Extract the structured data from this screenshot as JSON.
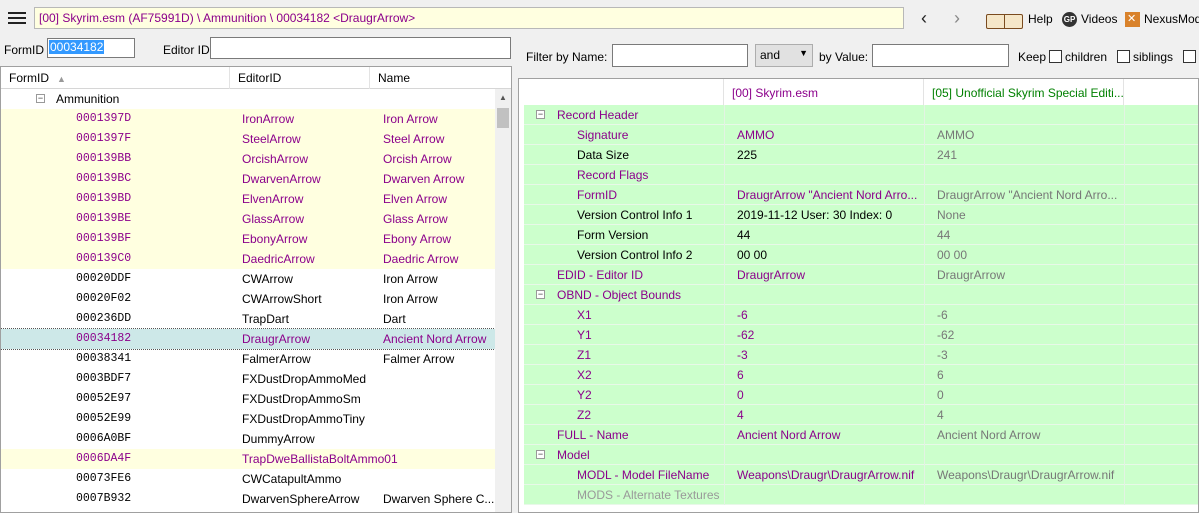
{
  "path": "[00] Skyrim.esm (AF75991D) \\ Ammunition \\ 00034182 <DraugrArrow>",
  "links": {
    "help": "Help",
    "videos": "Videos",
    "nexus": "NexusMods"
  },
  "icons": {
    "menu": "hamburger-icon",
    "back": "back-arrow-icon",
    "forward": "forward-arrow-icon",
    "help": "book-icon",
    "videos": "gp-icon",
    "nexus": "nexus-icon"
  },
  "formid": {
    "label": "FormID",
    "value": "00034182"
  },
  "editorid": {
    "label": "Editor ID",
    "value": ""
  },
  "left": {
    "headers": [
      "FormID",
      "EditorID",
      "Name"
    ],
    "group": "Ammunition",
    "rows": [
      {
        "formid": "0001397D",
        "editorid": "IronArrow",
        "name": "Iron Arrow",
        "style": "yellow"
      },
      {
        "formid": "0001397F",
        "editorid": "SteelArrow",
        "name": "Steel Arrow",
        "style": "yellow"
      },
      {
        "formid": "000139BB",
        "editorid": "OrcishArrow",
        "name": "Orcish Arrow",
        "style": "yellow"
      },
      {
        "formid": "000139BC",
        "editorid": "DwarvenArrow",
        "name": "Dwarven Arrow",
        "style": "yellow"
      },
      {
        "formid": "000139BD",
        "editorid": "ElvenArrow",
        "name": "Elven Arrow",
        "style": "yellow"
      },
      {
        "formid": "000139BE",
        "editorid": "GlassArrow",
        "name": "Glass Arrow",
        "style": "yellow"
      },
      {
        "formid": "000139BF",
        "editorid": "EbonyArrow",
        "name": "Ebony Arrow",
        "style": "yellow"
      },
      {
        "formid": "000139C0",
        "editorid": "DaedricArrow",
        "name": "Daedric Arrow",
        "style": "yellow"
      },
      {
        "formid": "00020DDF",
        "editorid": "CWArrow",
        "name": "Iron Arrow",
        "style": "plain"
      },
      {
        "formid": "00020F02",
        "editorid": "CWArrowShort",
        "name": "Iron Arrow",
        "style": "plain"
      },
      {
        "formid": "000236DD",
        "editorid": "TrapDart",
        "name": "Dart",
        "style": "plain"
      },
      {
        "formid": "00034182",
        "editorid": "DraugrArrow",
        "name": "Ancient Nord Arrow",
        "style": "selected"
      },
      {
        "formid": "00038341",
        "editorid": "FalmerArrow",
        "name": "Falmer Arrow",
        "style": "plain"
      },
      {
        "formid": "0003BDF7",
        "editorid": "FXDustDropAmmoMed",
        "name": "",
        "style": "plain"
      },
      {
        "formid": "00052E97",
        "editorid": "FXDustDropAmmoSm",
        "name": "",
        "style": "plain"
      },
      {
        "formid": "00052E99",
        "editorid": "FXDustDropAmmoTiny",
        "name": "",
        "style": "plain"
      },
      {
        "formid": "0006A0BF",
        "editorid": "DummyArrow",
        "name": "",
        "style": "plain"
      },
      {
        "formid": "0006DA4F",
        "editorid": "TrapDweBallistaBoltAmmo01",
        "name": "",
        "style": "yellow"
      },
      {
        "formid": "00073FE6",
        "editorid": "CWCatapultAmmo",
        "name": "",
        "style": "plain"
      },
      {
        "formid": "0007B932",
        "editorid": "DwarvenSphereArrow",
        "name": "Dwarven Sphere C...",
        "style": "plain"
      }
    ]
  },
  "filter": {
    "by_name": "Filter by Name:",
    "op": "and",
    "by_value": "by Value:",
    "keep": "Keep",
    "children": "children",
    "siblings": "siblings"
  },
  "right": {
    "headers": [
      "[00] Skyrim.esm",
      "[05] Unofficial Skyrim Special Editi..."
    ],
    "rows": [
      {
        "label": "Record Header",
        "level": 0,
        "exp": "−",
        "v1": "",
        "v2": "",
        "lc": "mg"
      },
      {
        "label": "Signature",
        "level": 1,
        "v1": "AMMO",
        "v2": "AMMO",
        "lc": "mg",
        "vc": "mg"
      },
      {
        "label": "Data Size",
        "level": 1,
        "v1": "225",
        "v2": "241",
        "lc": "",
        "vc": ""
      },
      {
        "label": "Record Flags",
        "level": 1,
        "v1": "",
        "v2": "",
        "lc": "mg",
        "vc": ""
      },
      {
        "label": "FormID",
        "level": 1,
        "v1": "DraugrArrow \"Ancient Nord Arro...",
        "v2": "DraugrArrow \"Ancient Nord Arro...",
        "lc": "mg",
        "vc": "mg"
      },
      {
        "label": "Version Control Info 1",
        "level": 1,
        "v1": "2019-11-12 User: 30 Index: 0",
        "v2": "None",
        "lc": "",
        "vc": ""
      },
      {
        "label": "Form Version",
        "level": 1,
        "v1": "44",
        "v2": "44",
        "lc": "",
        "vc": ""
      },
      {
        "label": "Version Control Info 2",
        "level": 1,
        "v1": "00 00",
        "v2": "00 00",
        "lc": "",
        "vc": ""
      },
      {
        "label": "EDID - Editor ID",
        "level": 0,
        "v1": "DraugrArrow",
        "v2": "DraugrArrow",
        "lc": "mg",
        "vc": "mg"
      },
      {
        "label": "OBND - Object Bounds",
        "level": 0,
        "exp": "−",
        "v1": "",
        "v2": "",
        "lc": "mg",
        "vc": ""
      },
      {
        "label": "X1",
        "level": 1,
        "v1": "-6",
        "v2": "-6",
        "lc": "mg",
        "vc": "mg"
      },
      {
        "label": "Y1",
        "level": 1,
        "v1": "-62",
        "v2": "-62",
        "lc": "mg",
        "vc": "mg"
      },
      {
        "label": "Z1",
        "level": 1,
        "v1": "-3",
        "v2": "-3",
        "lc": "mg",
        "vc": "mg"
      },
      {
        "label": "X2",
        "level": 1,
        "v1": "6",
        "v2": "6",
        "lc": "mg",
        "vc": "mg"
      },
      {
        "label": "Y2",
        "level": 1,
        "v1": "0",
        "v2": "0",
        "lc": "mg",
        "vc": "mg"
      },
      {
        "label": "Z2",
        "level": 1,
        "v1": "4",
        "v2": "4",
        "lc": "mg",
        "vc": "mg"
      },
      {
        "label": "FULL - Name",
        "level": 0,
        "v1": "Ancient Nord Arrow",
        "v2": "Ancient Nord Arrow",
        "lc": "mg",
        "vc": "mg"
      },
      {
        "label": "Model",
        "level": 0,
        "exp": "−",
        "v1": "",
        "v2": "",
        "lc": "mg",
        "vc": ""
      },
      {
        "label": "MODL - Model FileName",
        "level": 1,
        "v1": "Weapons\\Draugr\\DraugrArrow.nif",
        "v2": "Weapons\\Draugr\\DraugrArrow.nif",
        "lc": "mg",
        "vc": "mg"
      },
      {
        "label": "MODS - Alternate Textures",
        "level": 1,
        "v1": "",
        "v2": "",
        "lc": "gr",
        "vc": ""
      }
    ]
  }
}
